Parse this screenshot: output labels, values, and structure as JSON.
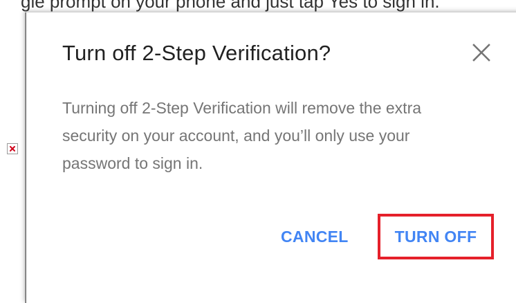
{
  "background": {
    "partial_text": "gle prompt on your phone and just tap Yes to sign in."
  },
  "dialog": {
    "title": "Turn off 2-Step Verification?",
    "body": "Turning off 2-Step Verification will remove the extra security on your account, and you’ll only use your password to sign in.",
    "close_icon": "close-icon",
    "buttons": {
      "cancel_label": "CANCEL",
      "turn_off_label": "TURN OFF"
    }
  },
  "colors": {
    "accent": "#4285f4",
    "highlight": "#e5202a",
    "title": "#212121",
    "body": "#757575"
  }
}
